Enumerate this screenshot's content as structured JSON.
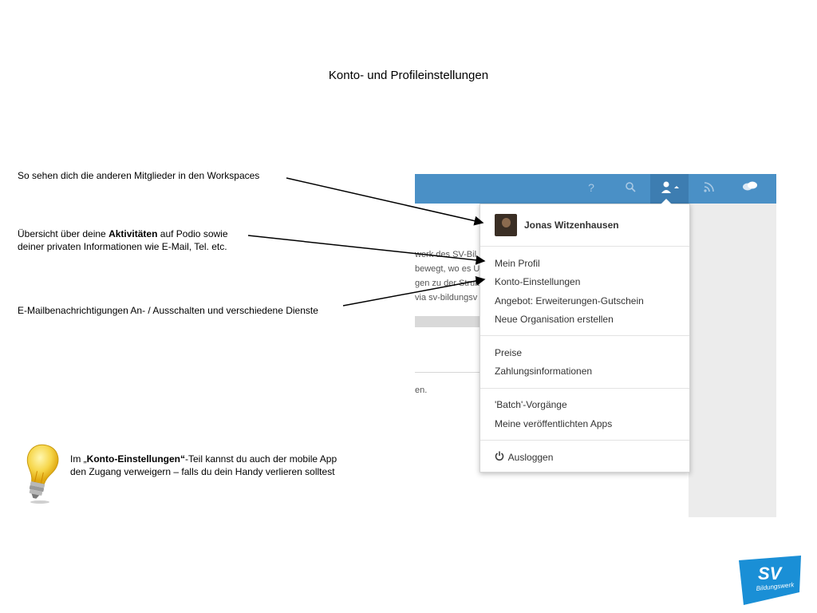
{
  "slide": {
    "title": "Konto- und Profileinstellungen"
  },
  "annotations": {
    "a1": "So sehen dich die anderen Mitglieder in den Workspaces",
    "a2_part1": "Übersicht über deine ",
    "a2_bold": "Aktivitäten",
    "a2_part2": " auf Podio sowie deiner privaten Informationen wie E-Mail, Tel. etc.",
    "a3": "E-Mailbenachrichtigungen An- / Ausschalten und verschiedene Dienste"
  },
  "tip": {
    "part1": "Im „",
    "bold": "Konto-Einstellungen“",
    "part2": "-Teil kannst du auch der mobile App den Zugang verweigern – falls du dein Handy verlieren solltest"
  },
  "screenshot": {
    "topbar_icons": [
      "question-icon",
      "search-icon",
      "user-icon",
      "rss-icon",
      "chat-icon"
    ],
    "background_text": [
      "werk des SV-Bil",
      "bewegt, wo es U",
      "gen zu der Struk",
      "via sv-bildungsv",
      "en."
    ],
    "dropdown": {
      "user_name": "Jonas Witzenhausen",
      "group1": [
        "Mein Profil",
        "Konto-Einstellungen",
        "Angebot: Erweiterungen-Gutschein",
        "Neue Organisation erstellen"
      ],
      "group2": [
        "Preise",
        "Zahlungsinformationen"
      ],
      "group3": [
        "'Batch'-Vorgänge",
        "Meine veröffentlichten Apps"
      ],
      "logout": "Ausloggen"
    },
    "colors": {
      "topbar": "#4a90c6",
      "active": "#3d7db1"
    }
  },
  "logo": {
    "text": "SV",
    "subtext": "Bildungswerk",
    "color": "#1a8fd6"
  }
}
